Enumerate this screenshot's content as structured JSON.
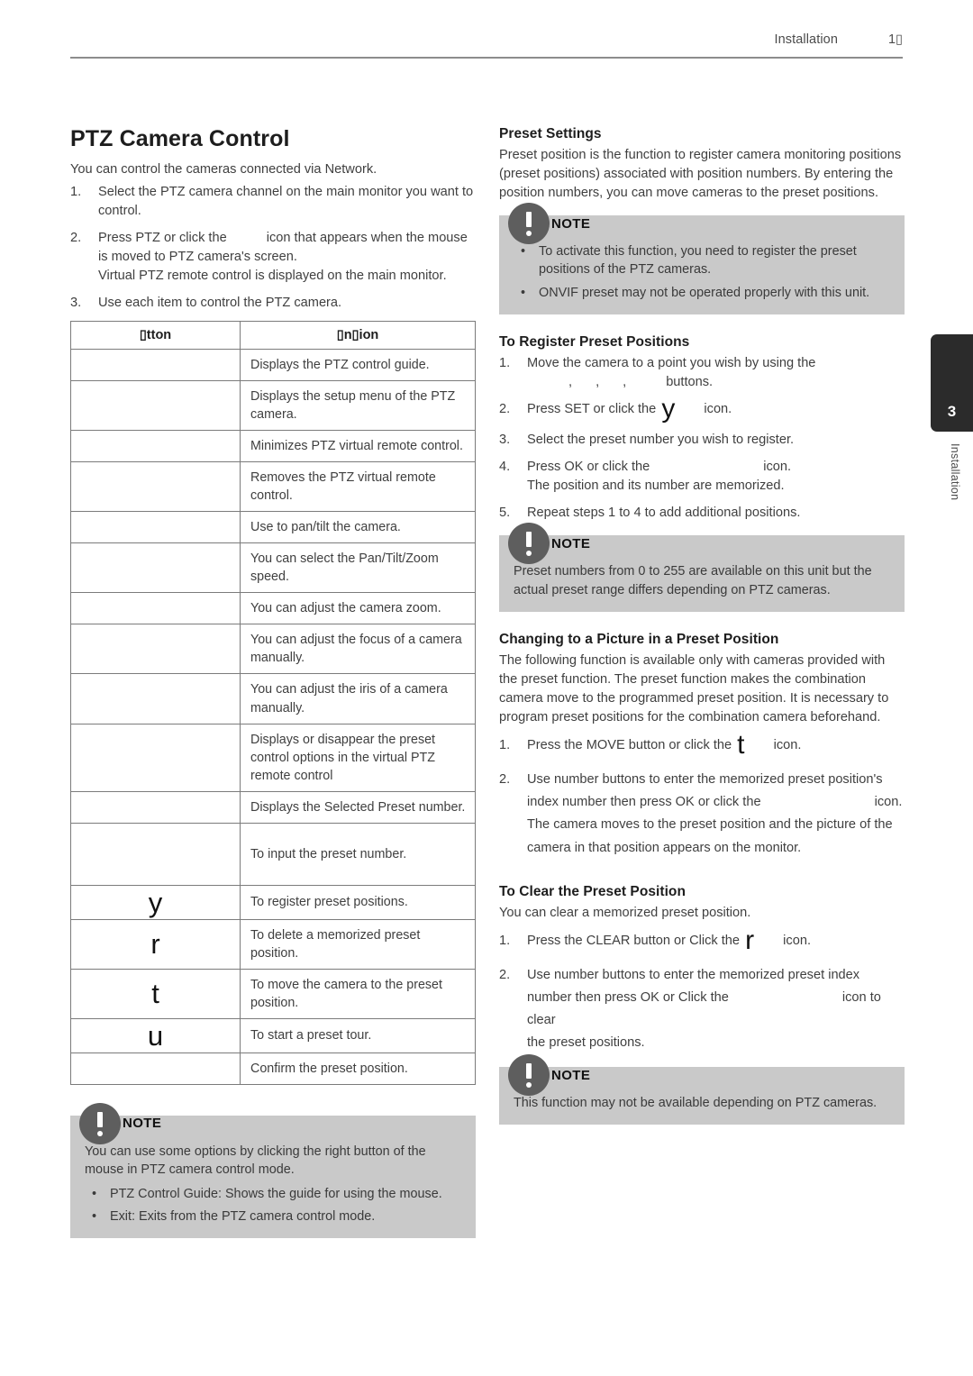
{
  "header": {
    "chapter_name": "Installation",
    "page_number": "1▯"
  },
  "side_tab": {
    "number": "3",
    "label": "Installation"
  },
  "left_column": {
    "title": "PTZ Camera Control",
    "intro": "You can control the cameras connected via Network.",
    "steps": [
      {
        "marker": "1.",
        "text": "Select the PTZ camera channel on the main monitor you want to control."
      },
      {
        "marker": "2.",
        "text_before_icon": "Press PTZ or click the",
        "text_after_icon": "icon that appears when the mouse is moved to PTZ camera's screen.",
        "extra_line": "Virtual PTZ remote control is displayed on the main monitor."
      },
      {
        "marker": "3.",
        "text": "Use each item to control the PTZ camera."
      }
    ],
    "table": {
      "headers": [
        "▯tton",
        "▯n▯ion"
      ],
      "rows": [
        {
          "button": "",
          "function": "Displays the PTZ control guide."
        },
        {
          "button": "",
          "function": "Displays the setup menu of the PTZ camera."
        },
        {
          "button": "",
          "function": "Minimizes PTZ virtual remote control."
        },
        {
          "button": "",
          "function": "Removes the PTZ virtual remote control."
        },
        {
          "button": "",
          "function": "Use to pan/tilt the camera."
        },
        {
          "button": "",
          "function": "You can select the Pan/Tilt/Zoom speed."
        },
        {
          "button": "",
          "function": "You can adjust the camera zoom."
        },
        {
          "button": "",
          "function": "You can adjust the focus of a camera manually."
        },
        {
          "button": "",
          "function": "You can adjust the iris of a camera manually."
        },
        {
          "button": "",
          "function": "Displays or disappear the preset control options in the virtual PTZ remote control"
        },
        {
          "button": "",
          "function": "Displays the Selected Preset number."
        },
        {
          "button": "",
          "function": "To input the preset number."
        },
        {
          "button": "y",
          "function": "To register preset positions."
        },
        {
          "button": "r",
          "function": "To delete a memorized preset position."
        },
        {
          "button": "t",
          "function": "To move the camera to the preset position."
        },
        {
          "button": "u",
          "function": "To start a preset tour."
        },
        {
          "button": "",
          "function": "Confirm the preset position."
        }
      ]
    },
    "note": {
      "title": "NOTE",
      "paragraph": "You can use some options by clicking the right button of the mouse in PTZ camera control mode.",
      "bullets": [
        "PTZ Control Guide: Shows the guide for using the mouse.",
        "Exit: Exits from the PTZ camera control mode."
      ]
    }
  },
  "right_column": {
    "preset_settings": {
      "title": "Preset Settings",
      "paragraph": "Preset position is the function to register camera monitoring positions (preset positions) associated with position numbers. By entering the position numbers, you can move cameras to the preset positions."
    },
    "note_1": {
      "title": "NOTE",
      "bullets": [
        "To activate this function, you need to register the preset positions of the PTZ cameras.",
        "ONVIF preset may not be operated properly with this unit."
      ]
    },
    "register": {
      "title": "To Register Preset Positions",
      "steps": [
        {
          "marker": "1.",
          "text": "Move the camera to a point you wish by using the",
          "icon_line_suffix": "buttons.",
          "icon_separators": [
            ",",
            ",",
            ","
          ]
        },
        {
          "marker": "2.",
          "text_before_icon": "Press SET or click the",
          "icon": "y",
          "text_after_icon": "icon."
        },
        {
          "marker": "3.",
          "text": "Select the preset number you wish to register."
        },
        {
          "marker": "4.",
          "text_before_icon": "Press OK or click the",
          "text_after_icon": "icon.",
          "extra_line": "The position and its number are memorized."
        },
        {
          "marker": "5.",
          "text": "Repeat steps 1 to 4 to add additional positions."
        }
      ]
    },
    "note_2": {
      "title": "NOTE",
      "paragraph": "Preset numbers from 0 to 255 are available on this unit but the actual preset range differs depending on PTZ cameras."
    },
    "changing": {
      "title": "Changing to a Picture in a Preset Position",
      "paragraph": "The following function is available only with cameras provided with the preset function. The preset function makes the combination camera move to the programmed preset position. It is necessary to program preset positions for the combination camera beforehand.",
      "steps": [
        {
          "marker": "1.",
          "text_before_icon": "Press the MOVE button or click the",
          "icon": "t",
          "text_after_icon": "icon."
        },
        {
          "marker": "2.",
          "text_line_1": "Use number buttons to enter the memorized preset position's",
          "text_line_2_before_icon": "index number then press OK or click the",
          "text_line_2_after_icon": "icon.",
          "text_line_3": "The camera moves to the preset position and the picture of the camera in that position appears on the monitor."
        }
      ]
    },
    "clear": {
      "title": "To Clear the Preset Position",
      "paragraph": "You can clear a memorized preset position.",
      "steps": [
        {
          "marker": "1.",
          "text_before_icon": "Press the CLEAR button or Click the",
          "icon": "r",
          "text_after_icon": "icon."
        },
        {
          "marker": "2.",
          "text_line_1": "Use number buttons to enter the memorized preset index",
          "text_line_2_before_icon": "number then press OK or Click the",
          "text_line_2_after_icon": "icon to clear",
          "text_line_3": "the preset positions."
        }
      ]
    },
    "note_3": {
      "title": "NOTE",
      "paragraph": "This function may not be available depending on PTZ cameras."
    }
  }
}
